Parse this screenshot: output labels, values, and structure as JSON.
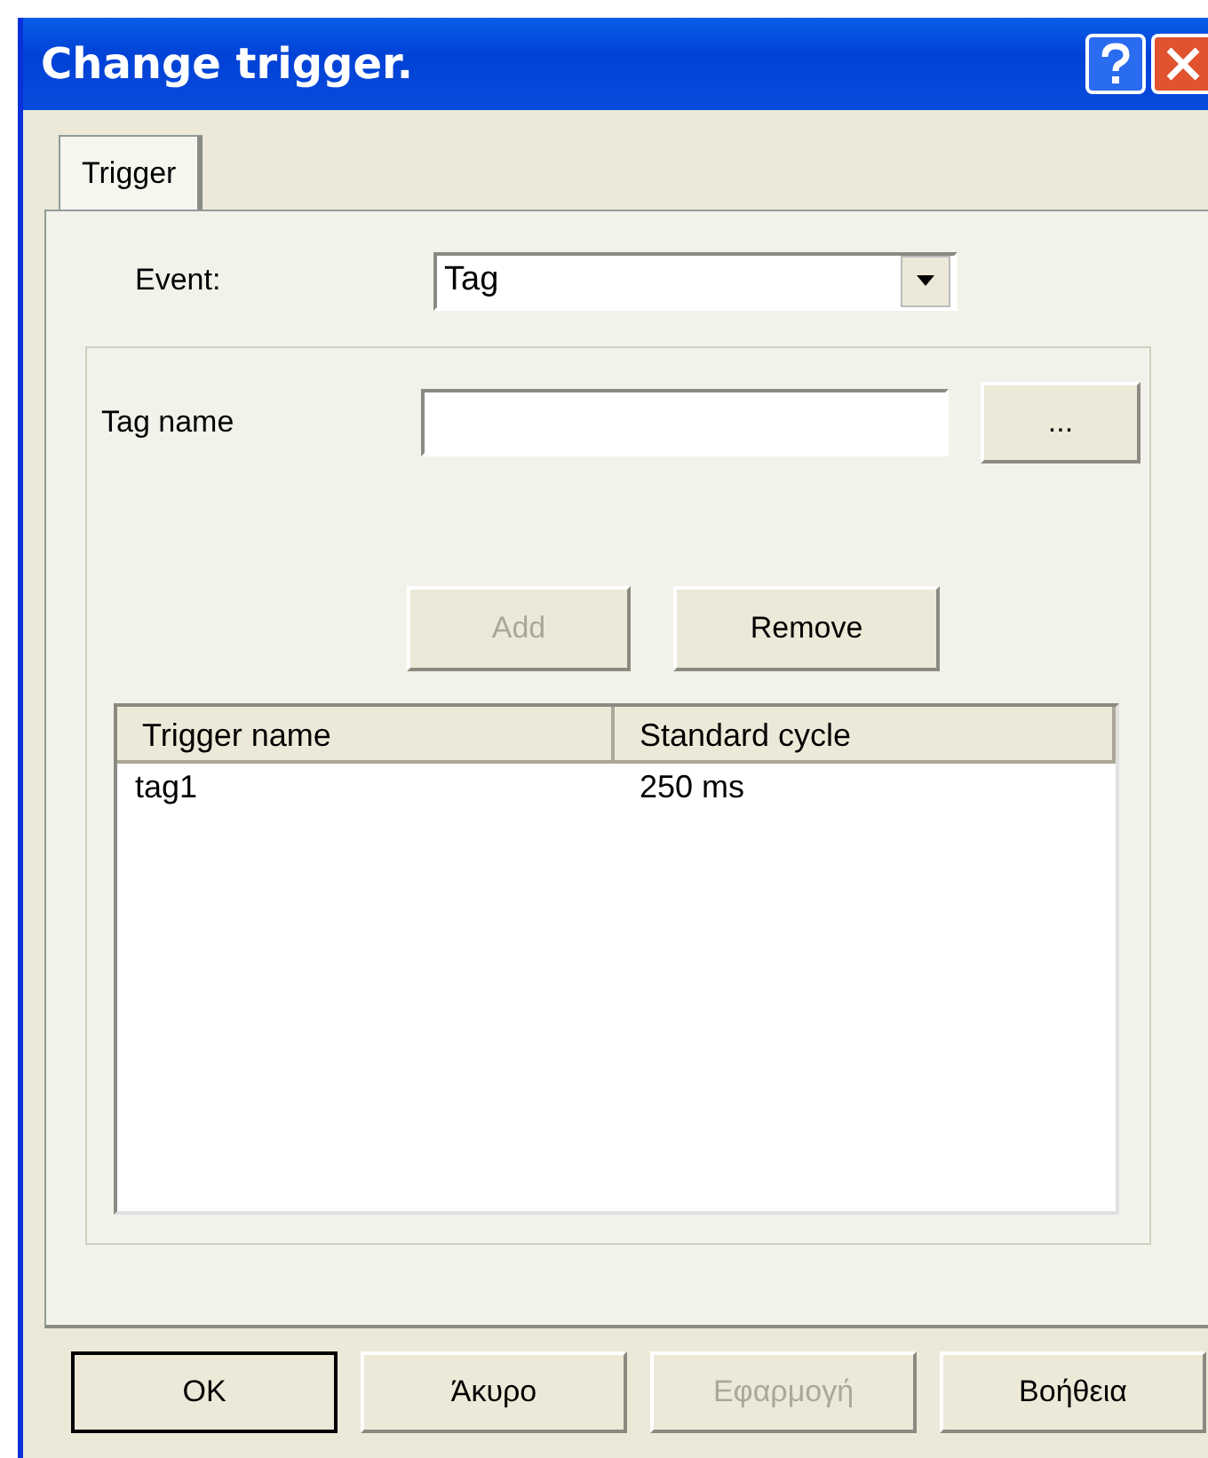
{
  "window": {
    "title": "Change trigger."
  },
  "tabs": [
    {
      "label": "Trigger",
      "selected": true
    }
  ],
  "event": {
    "label": "Event:",
    "value": "Tag"
  },
  "tag_name": {
    "label": "Tag name",
    "browse": "..."
  },
  "actions": [
    {
      "label": "Add",
      "disabled": true
    },
    {
      "label": "Remove",
      "disabled": false
    }
  ],
  "list": {
    "columns": [
      "Trigger name",
      "Standard cycle"
    ],
    "rows": [
      [
        "tag1",
        "250 ms"
      ]
    ]
  },
  "buttons": [
    {
      "label": "OK",
      "disabled": false,
      "default": true
    },
    {
      "label": "Άκυρο",
      "disabled": false,
      "default": false
    },
    {
      "label": "Εφαρμογή",
      "disabled": true,
      "default": false
    },
    {
      "label": "Βοήθεια",
      "disabled": false,
      "default": false
    }
  ]
}
